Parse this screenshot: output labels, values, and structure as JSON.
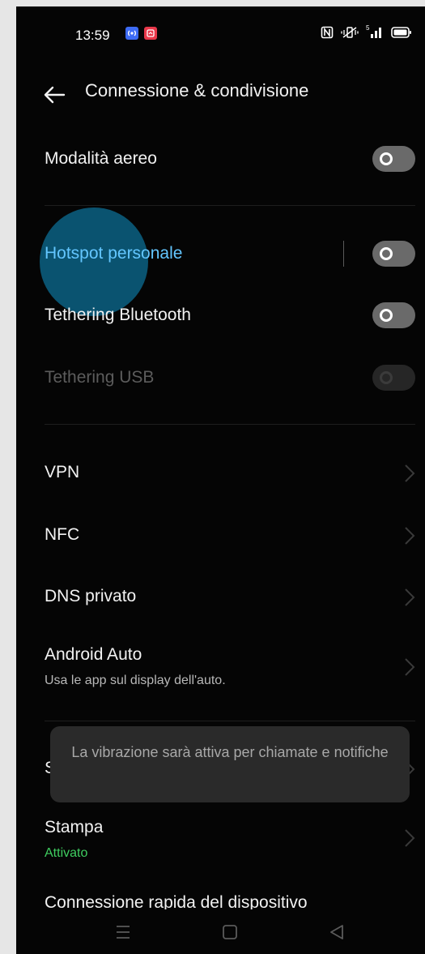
{
  "status_bar": {
    "time": "13:59",
    "notification_icons": [
      "broadcast-icon",
      "app-notification-icon"
    ],
    "system_icons": [
      "nfc-icon",
      "vibrate-icon",
      "signal-icon",
      "battery-icon"
    ],
    "signal_label": "5"
  },
  "header": {
    "title": "Connessione & condivisione",
    "back_icon": "arrow-left-icon"
  },
  "rows": {
    "airplane": {
      "label": "Modalità aereo",
      "toggle_on": false
    },
    "hotspot": {
      "label": "Hotspot personale",
      "toggle_on": false
    },
    "bt_tethering": {
      "label": "Tethering Bluetooth",
      "toggle_on": false
    },
    "usb_tethering": {
      "label": "Tethering USB",
      "toggle_on": false,
      "enabled": false
    },
    "vpn": {
      "label": "VPN"
    },
    "nfc": {
      "label": "NFC"
    },
    "dns": {
      "label": "DNS privato"
    },
    "android_auto": {
      "label": "Android Auto",
      "subtitle": "Usa le app sul display dell'auto."
    },
    "hidden_row": {
      "partial_label": "S"
    },
    "print": {
      "label": "Stampa",
      "subtitle": "Attivato"
    },
    "quick_connect": {
      "label": "Connessione rapida del dispositivo"
    }
  },
  "toast": {
    "message": "La vibrazione sarà attiva per chiamate e notifiche"
  },
  "colors": {
    "background": "#050505",
    "highlight_text": "#63c6ff",
    "touch_indicator": "#0b5a7a",
    "status_green": "#3fce60",
    "toggle_off": "#6a6a6a"
  },
  "nav_bar": {
    "icons": [
      "menu-icon",
      "home-icon",
      "back-triangle-icon"
    ]
  }
}
